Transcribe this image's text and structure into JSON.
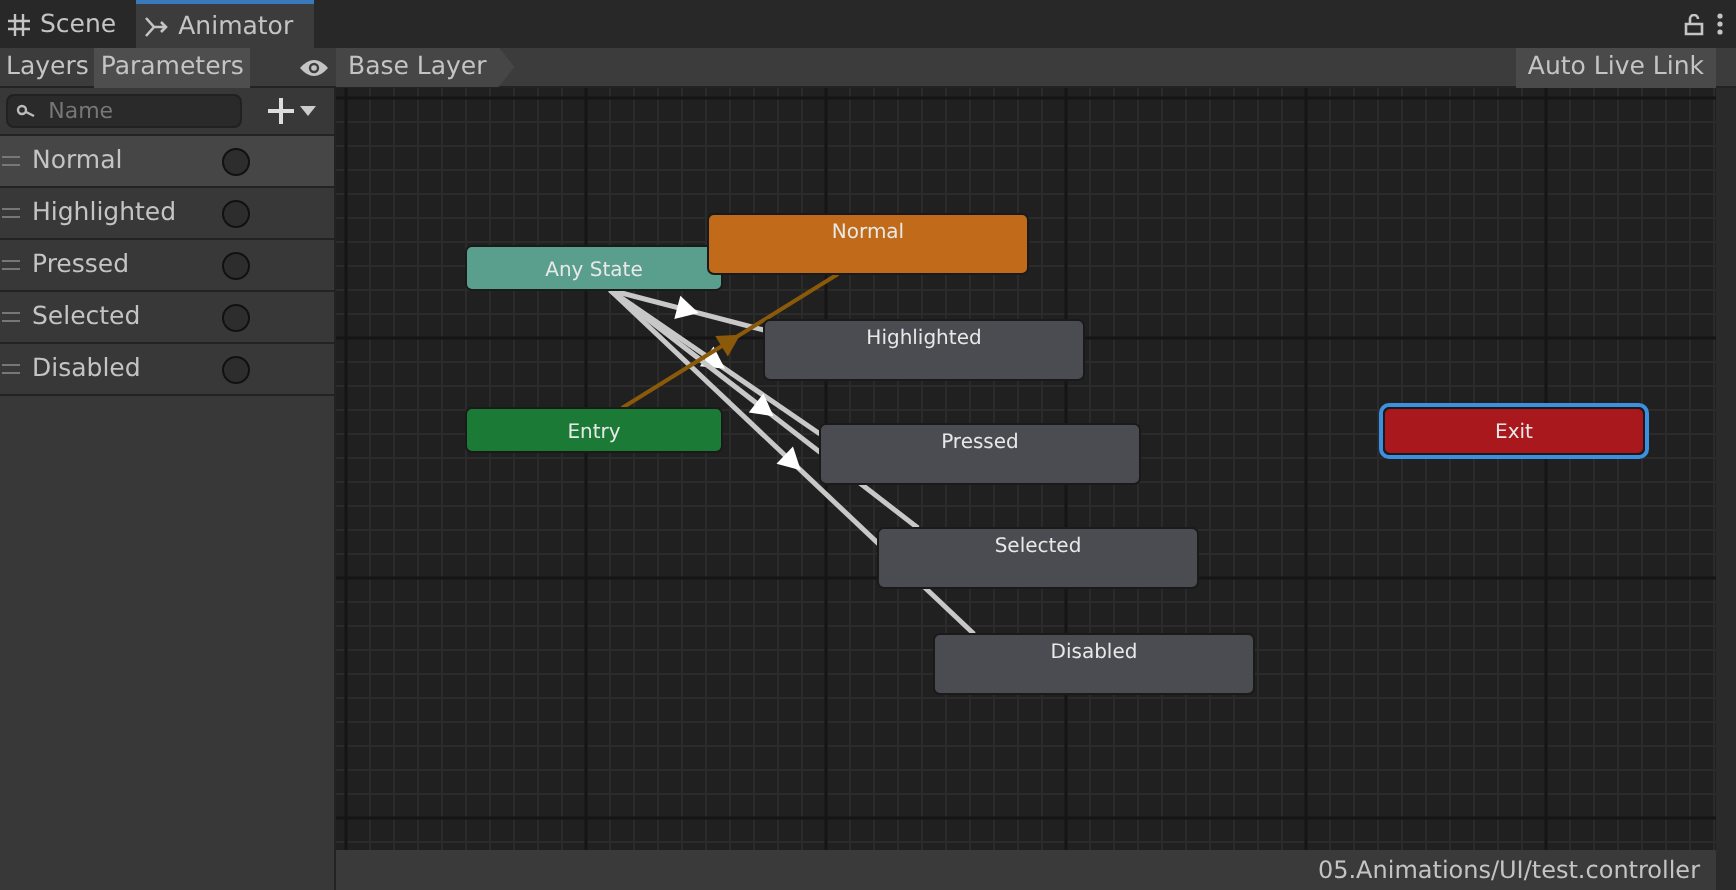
{
  "tabs": [
    {
      "label": "Scene",
      "selected": false
    },
    {
      "label": "Animator",
      "selected": true
    }
  ],
  "panel_tabs": [
    {
      "label": "Layers",
      "selected": false
    },
    {
      "label": "Parameters",
      "selected": true
    }
  ],
  "search": {
    "placeholder": "Name"
  },
  "parameters": [
    {
      "name": "Normal",
      "checked": false,
      "selected": true
    },
    {
      "name": "Highlighted",
      "checked": false,
      "selected": false
    },
    {
      "name": "Pressed",
      "checked": false,
      "selected": false
    },
    {
      "name": "Selected",
      "checked": false,
      "selected": false
    },
    {
      "name": "Disabled",
      "checked": false,
      "selected": false
    }
  ],
  "breadcrumb": "Base Layer",
  "auto_live_link": {
    "label": "Auto Live Link",
    "on": false
  },
  "nodes": [
    {
      "label": "Any State",
      "kind": "any",
      "selected": false
    },
    {
      "label": "Normal",
      "kind": "default",
      "selected": false
    },
    {
      "label": "Highlighted",
      "kind": "state",
      "selected": false
    },
    {
      "label": "Entry",
      "kind": "entry",
      "selected": false
    },
    {
      "label": "Pressed",
      "kind": "state",
      "selected": false
    },
    {
      "label": "Selected",
      "kind": "state",
      "selected": false
    },
    {
      "label": "Disabled",
      "kind": "state",
      "selected": false
    },
    {
      "label": "Exit",
      "kind": "exit",
      "selected": true
    }
  ],
  "status_bar": "05.Animations/UI/test.controller"
}
